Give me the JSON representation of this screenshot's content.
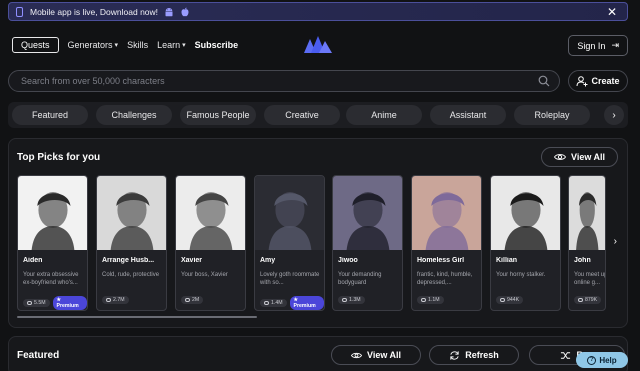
{
  "banner": {
    "text": "Mobile app is live, Download now!",
    "icons": [
      "phone-icon",
      "android-icon",
      "apple-icon",
      "close-icon"
    ]
  },
  "nav": {
    "quests": "Quests",
    "generators": "Generators",
    "skills": "Skills",
    "learn": "Learn",
    "subscribe": "Subscribe",
    "signin": "Sign In"
  },
  "search": {
    "placeholder": "Search from over 50,000 characters"
  },
  "create": {
    "label": "Create"
  },
  "categories": [
    "Featured",
    "Challenges",
    "Famous People",
    "Creative",
    "Anime",
    "Assistant",
    "Roleplay"
  ],
  "top_picks": {
    "title": "Top Picks for you",
    "view_all": "View All",
    "cards": [
      {
        "name": "Aiden",
        "desc": "Your extra obsessive ex-boyfriend who's...",
        "count": "5.5M",
        "premium": "Premium"
      },
      {
        "name": "Arrange Husb...",
        "desc": "Cold, rude, protective",
        "count": "2.7M",
        "premium": ""
      },
      {
        "name": "Xavier",
        "desc": "Your boss, Xavier",
        "count": "2M",
        "premium": ""
      },
      {
        "name": "Amy",
        "desc": "Lovely goth roommate with so...",
        "count": "1.4M",
        "premium": "Premium"
      },
      {
        "name": "Jiwoo",
        "desc": "Your demanding bodyguard",
        "count": "1.3M",
        "premium": ""
      },
      {
        "name": "Homeless Girl",
        "desc": "frantic, kind, humble, depressed,...",
        "count": "1.1M",
        "premium": ""
      },
      {
        "name": "Killian",
        "desc": "Your horny stalker.",
        "count": "944K",
        "premium": ""
      },
      {
        "name": "John",
        "desc": "You meet up your online g...",
        "count": "879K",
        "premium": ""
      }
    ]
  },
  "featured": {
    "title": "Featured",
    "view_all": "View All",
    "refresh": "Refresh",
    "random": "Ran"
  },
  "help": {
    "label": "Help"
  },
  "colors": {
    "accent": "#4b46d9",
    "banner_border": "#4b4f9a",
    "help_bg": "#8fc7e7",
    "background": "#111214"
  }
}
